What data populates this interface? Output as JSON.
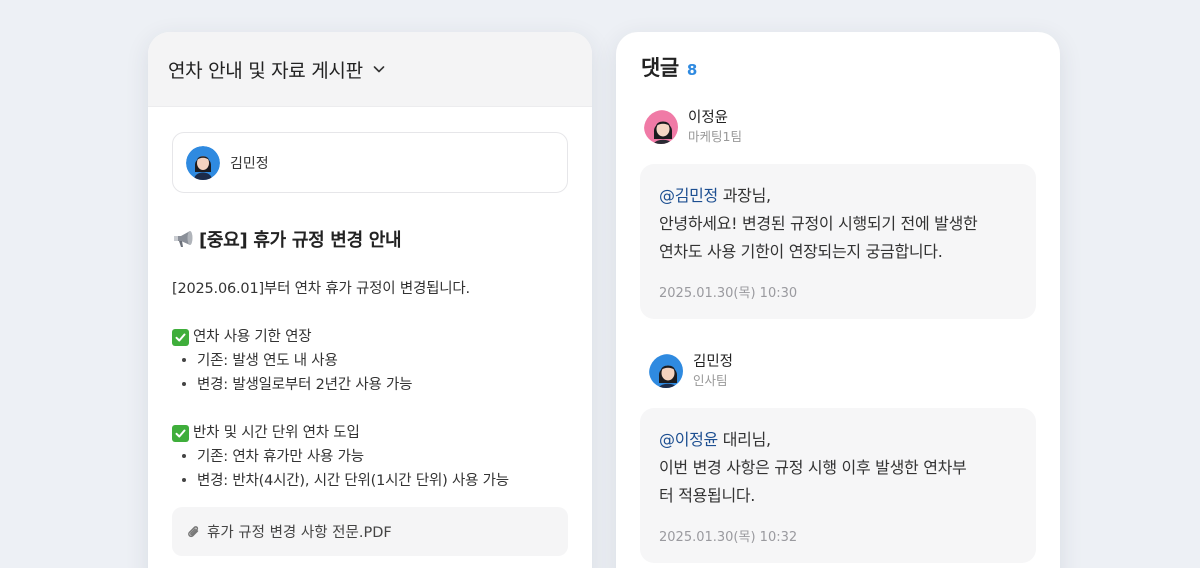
{
  "board": {
    "title": "연차 안내 및 자료 게시판",
    "author": "김민정",
    "post_title": "[중요] 휴가 규정 변경 안내",
    "intro": "[2025.06.01]부터 연차 휴가 규정이 변경됩니다.",
    "sections": [
      {
        "heading": "연차 사용 기한 연장",
        "bullets": [
          "기존: 발생 연도 내 사용",
          "변경: 발생일로부터 2년간 사용 가능"
        ]
      },
      {
        "heading": "반차 및 시간 단위 연차 도입",
        "bullets": [
          "기존: 연차 휴가만 사용 가능",
          "변경: 반차(4시간), 시간 단위(1시간 단위) 사용 가능"
        ]
      }
    ],
    "attachment": "휴가 규정 변경 사항 전문.PDF"
  },
  "comments": {
    "title": "댓글",
    "count": "8",
    "items": [
      {
        "name": "이정윤",
        "team": "마케팅1팀",
        "mention": "@김민정",
        "first_line_rest": " 과장님,",
        "lines": [
          "안녕하세요! 변경된 규정이 시행되기 전에 발생한",
          "연차도 사용 기한이 연장되는지 궁금합니다."
        ],
        "time": "2025.01.30(목) 10:30"
      },
      {
        "name": "김민정",
        "team": "인사팀",
        "mention": "@이정윤",
        "first_line_rest": " 대리님,",
        "lines": [
          "이번 변경 사항은 규정 시행 이후 발생한 연차부",
          "터 적용됩니다."
        ],
        "time": "2025.01.30(목) 10:32"
      }
    ]
  },
  "colors": {
    "accent": "#2f8ae0",
    "mention": "#1d4f91",
    "check": "#3fae3b",
    "background": "#edf0f5"
  },
  "icons": {
    "chevron": "chevron-down-icon",
    "megaphone": "megaphone-icon",
    "check": "check-box-icon",
    "attachment": "paperclip-icon"
  }
}
